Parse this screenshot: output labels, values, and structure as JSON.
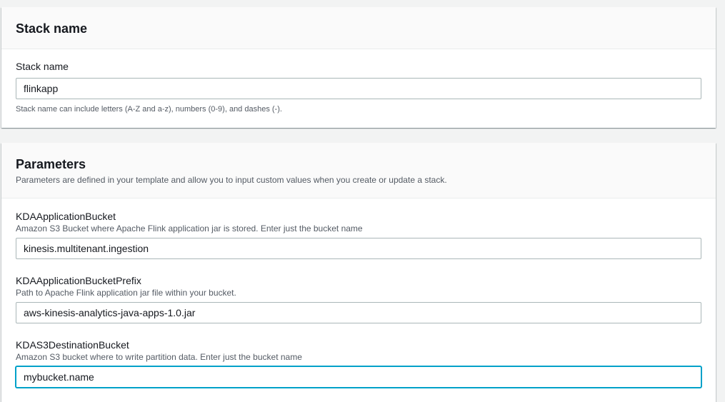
{
  "stack_section": {
    "title": "Stack name",
    "field_label": "Stack name",
    "field_value": "flinkapp",
    "constraint": "Stack name can include letters (A-Z and a-z), numbers (0-9), and dashes (-)."
  },
  "parameters_section": {
    "title": "Parameters",
    "description": "Parameters are defined in your template and allow you to input custom values when you create or update a stack.",
    "fields": [
      {
        "label": "KDAApplicationBucket",
        "description": "Amazon S3 Bucket where Apache Flink application jar is stored. Enter just the bucket name",
        "value": "kinesis.multitenant.ingestion"
      },
      {
        "label": "KDAApplicationBucketPrefix",
        "description": "Path to Apache Flink application jar file within your bucket.",
        "value": "aws-kinesis-analytics-java-apps-1.0.jar"
      },
      {
        "label": "KDAS3DestinationBucket",
        "description": "Amazon S3 bucket where to write partition data. Enter just the bucket name",
        "value": "mybucket.name"
      }
    ]
  },
  "colors": {
    "focus_border": "#00a1c9",
    "page_background": "#f2f3f3",
    "header_background": "#fafafa"
  }
}
